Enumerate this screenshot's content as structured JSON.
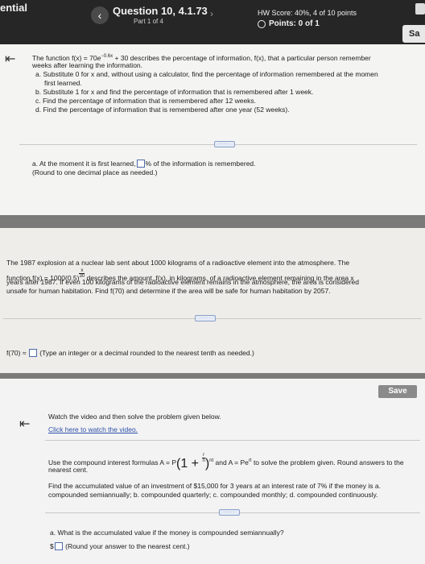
{
  "header": {
    "left_text": "ential",
    "prev_arrow": "‹",
    "question_title": "Question 10, 4.1.73",
    "part": "Part 1 of 4",
    "next_arrow": "›",
    "hw_score": "HW Score: 40%, 4 of 10 points",
    "points": "Points: 0 of 1",
    "save_label": "Sa"
  },
  "q1": {
    "line1_a": "The function f(x) = 70",
    "line1_e": "e",
    "line1_exp": "−0.6x",
    "line1_b": "+ 30 describes the percentage of information, f(x), that a particular person remember",
    "line2": "weeks after learning the information.",
    "item_a1": "a. Substitute 0 for x and, without using a calculator, find the percentage of information remembered at the momen",
    "item_a2": "first learned.",
    "item_b": "b. Substitute 1 for x and find the percentage of information that is remembered after 1 week.",
    "item_c": "c. Find the percentage of information that is remembered after 12 weeks.",
    "item_d": "d. Find the percentage of information that is remembered after one year (52 weeks).",
    "dots": "·····",
    "answer_a_pre": "a. At the moment it is first learned,",
    "answer_a_post": "% of the information is remembered.",
    "answer_hint": "(Round to one decimal place as needed.)"
  },
  "q2": {
    "line1": "The 1987 explosion at a nuclear lab sent about 1000 kilograms of a radioactive element into the atmosphere. The",
    "line2_a": "function f(x) = 1000(0.5)",
    "line2_exp_num": "x",
    "line2_exp_den": "30",
    "line2_b": "describes the amount, f(x), in kilograms, of a radioactive element remaining in the area x",
    "line3": "years after 1987. If even 100 kilograms of the radioactive element remains in the atmosphere, the area is considered",
    "line4": "unsafe for human habitation. Find f(70) and determine if the area will be safe for human habitation by 2057.",
    "dots": "·····",
    "answer_pre": "f(70) ≈",
    "answer_hint": "(Type an integer or a decimal rounded to the nearest tenth as needed.)"
  },
  "q3": {
    "save_label": "Save",
    "intro": "Watch the video and then solve the problem given below.",
    "link": "Click here to watch the video.",
    "formula_pre": "Use the compound interest formulas A = P",
    "formula_paren": "(1 + ",
    "formula_r": "r",
    "formula_n": "n",
    "formula_close": ")",
    "formula_exp": "nt",
    "formula_mid": "and A = Pe",
    "formula_exp2": "rt",
    "formula_post": "to solve the problem given. Round answers to the",
    "formula_line2": "nearest cent.",
    "task1": "Find the accumulated value of an investment of $15,000 for 3 years at an interest rate of 7% if the money is a.",
    "task2": "compounded semiannually; b. compounded quarterly; c. compounded monthly; d. compounded continuously.",
    "dots": "·····",
    "qa": "a. What is the accumulated value if the money is compounded semiannually?",
    "answer_prefix": "$",
    "answer_hint": "(Round your answer to the nearest cent.)"
  }
}
